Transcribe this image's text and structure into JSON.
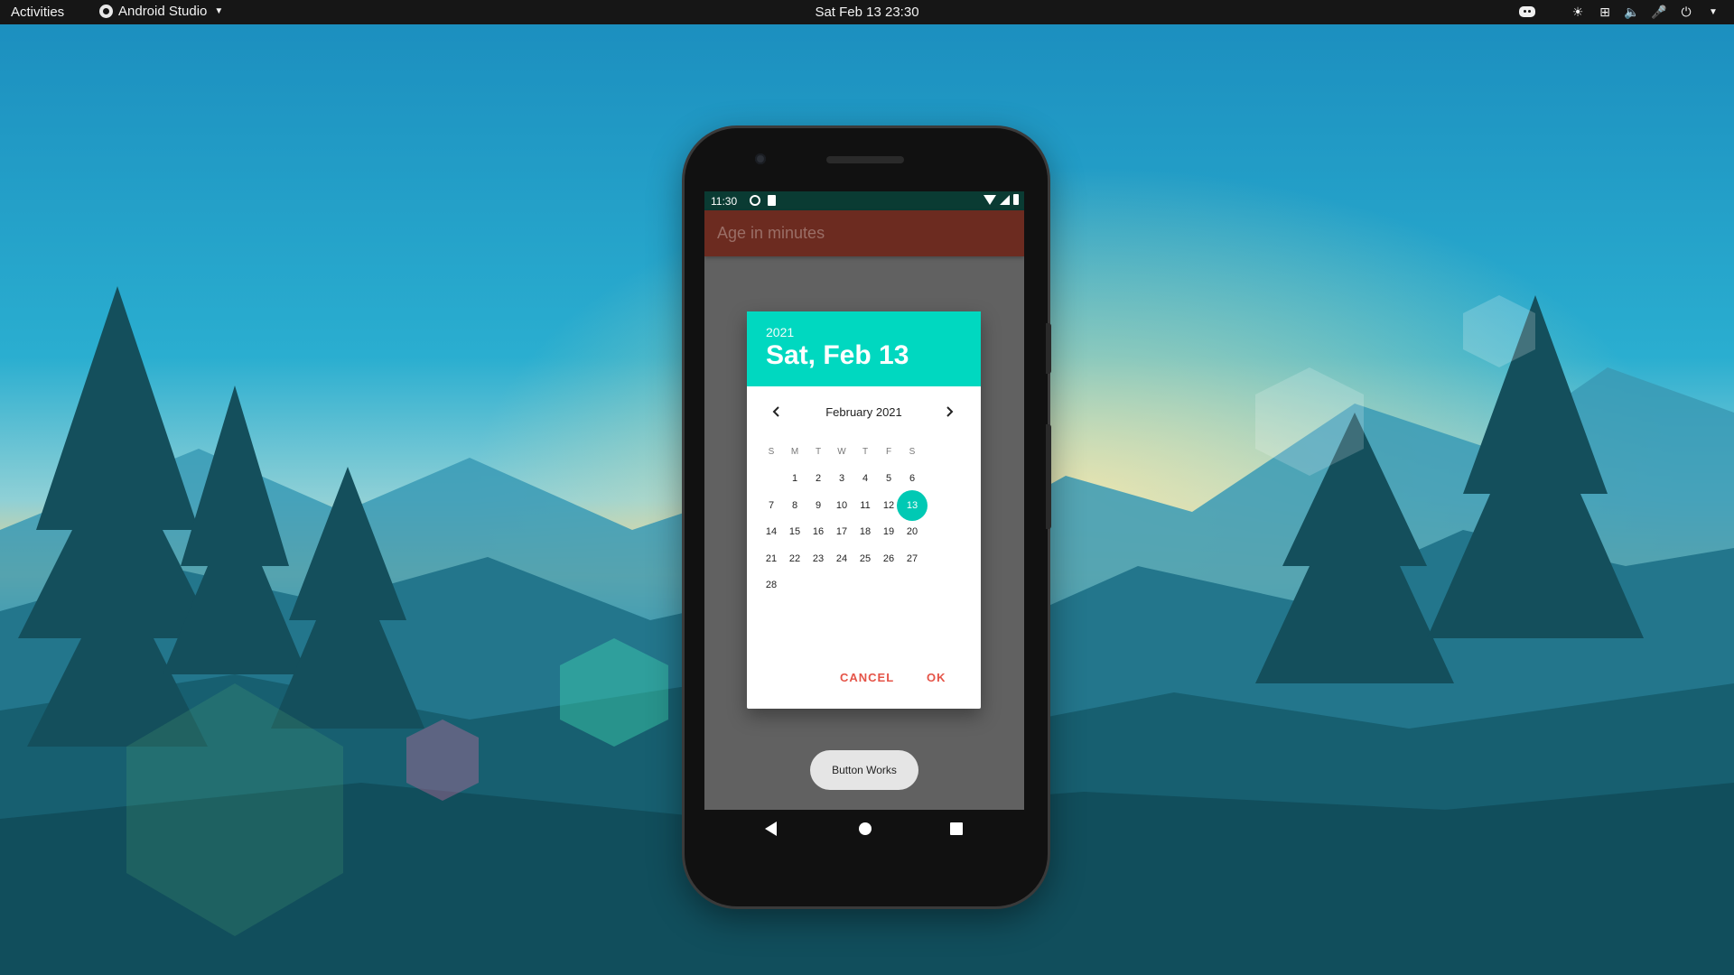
{
  "topbar": {
    "activities": "Activities",
    "app_name": "Android Studio",
    "clock": "Sat Feb 13  23:30"
  },
  "phone": {
    "status_time": "11:30",
    "app_title": "Age in minutes",
    "toast": "Button Works"
  },
  "date_picker": {
    "year": "2021",
    "selected_date": "Sat, Feb 13",
    "month_label": "February 2021",
    "weekdays": [
      "S",
      "M",
      "T",
      "W",
      "T",
      "F",
      "S"
    ],
    "days": [
      "1",
      "2",
      "3",
      "4",
      "5",
      "6",
      "7",
      "8",
      "9",
      "10",
      "11",
      "12",
      "13",
      "14",
      "15",
      "16",
      "17",
      "18",
      "19",
      "20",
      "21",
      "22",
      "23",
      "24",
      "25",
      "26",
      "27",
      "28"
    ],
    "first_weekday_index": 1,
    "selected_day": "13",
    "cancel_label": "CANCEL",
    "ok_label": "OK"
  },
  "colors": {
    "picker_header": "#00d8c0",
    "selected_day": "#00c9b4",
    "action_button": "#e55448",
    "app_bar": "#6c2b20",
    "status_bar": "#0a3b33"
  }
}
